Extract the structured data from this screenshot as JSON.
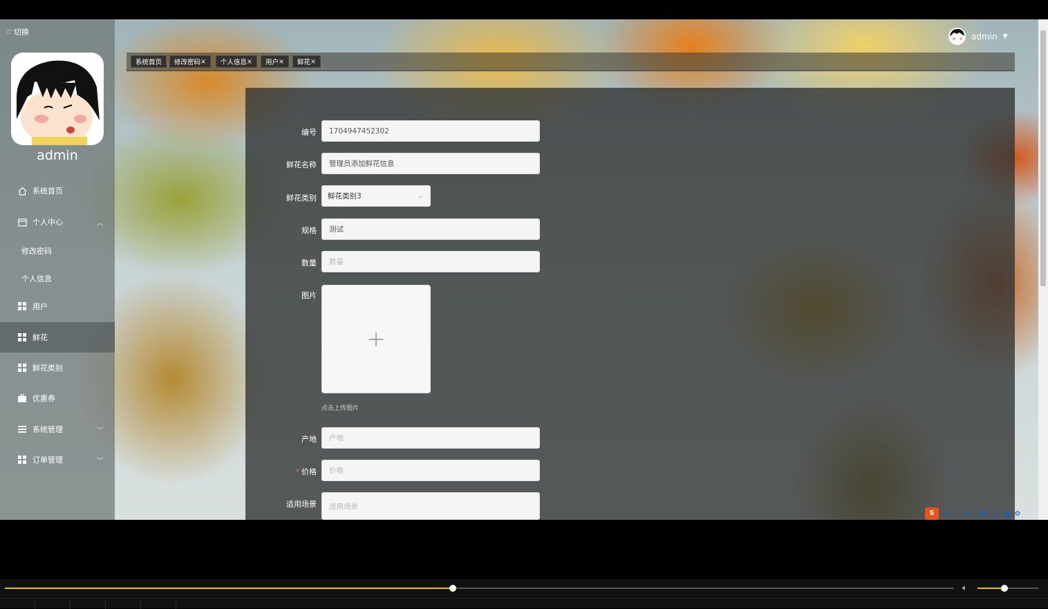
{
  "sidebar": {
    "switch_label": "切换",
    "username": "admin",
    "menu": [
      {
        "label": "系统首页",
        "icon": "home-icon"
      },
      {
        "label": "个人中心",
        "icon": "calendar-icon",
        "expanded": true
      },
      {
        "label": "用户",
        "icon": "grid-icon"
      },
      {
        "label": "鲜花",
        "icon": "grid-icon",
        "active": true
      },
      {
        "label": "鲜花类别",
        "icon": "grid-icon"
      },
      {
        "label": "优惠券",
        "icon": "briefcase-icon"
      },
      {
        "label": "系统管理",
        "icon": "list-icon"
      },
      {
        "label": "订单管理",
        "icon": "grid-icon"
      }
    ],
    "submenu": [
      "修改密码",
      "个人信息"
    ]
  },
  "header": {
    "username": "admin",
    "dropdown_arrow": "▼"
  },
  "tabs": [
    {
      "label": "系统首页"
    },
    {
      "label": "修改密码"
    },
    {
      "label": "个人信息"
    },
    {
      "label": "用户"
    },
    {
      "label": "鲜花"
    }
  ],
  "form": {
    "id_label": "编号",
    "id_value": "1704947452302",
    "name_label": "鲜花名称",
    "name_value": "管理员添加鲜花信息",
    "category_label": "鲜花类别",
    "category_value": "鲜花类别3",
    "spec_label": "规格",
    "spec_value": "测试",
    "qty_label": "数量",
    "qty_placeholder": "数量",
    "image_label": "图片",
    "upload_tip": "点击上传图片",
    "origin_label": "产地",
    "origin_placeholder": "产地",
    "price_label": "价格",
    "price_required_mark": "*",
    "price_placeholder": "价格",
    "scene_label": "适用场景",
    "scene_placeholder": "适用场景"
  },
  "player": {
    "progress": 0.472,
    "volume": 0.44
  },
  "ime": {
    "label": "中"
  },
  "colors": {
    "accent": "#e8c400",
    "required": "#f56c6c"
  }
}
